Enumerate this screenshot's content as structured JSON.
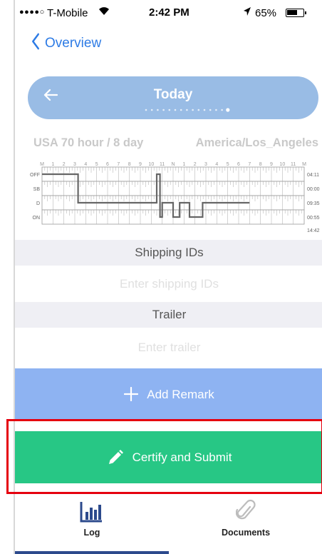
{
  "status_bar": {
    "signal": "●●●●○",
    "carrier": "T-Mobile",
    "time": "2:42 PM",
    "battery": "65%",
    "battery_level": 0.65
  },
  "nav": {
    "back_label": "Overview"
  },
  "day_selector": {
    "title": "Today",
    "page_count": 15,
    "active_page": 14
  },
  "log_info": {
    "ruleset": "USA 70 hour / 8 day",
    "timezone": "America/Los_Angeles"
  },
  "graph": {
    "hour_labels": [
      "M",
      "1",
      "2",
      "3",
      "4",
      "5",
      "6",
      "7",
      "8",
      "9",
      "10",
      "11",
      "N",
      "1",
      "2",
      "3",
      "4",
      "5",
      "6",
      "7",
      "8",
      "9",
      "10",
      "11",
      "M"
    ],
    "status_rows": [
      "OFF",
      "SB",
      "D",
      "ON"
    ],
    "totals": [
      "04:11",
      "00:00",
      "09:35",
      "00:55"
    ],
    "grand_total": "14:42",
    "line_color": "#666666"
  },
  "sections": {
    "shipping_header": "Shipping IDs",
    "shipping_placeholder": "Enter shipping IDs",
    "trailer_header": "Trailer",
    "trailer_placeholder": "Enter trailer"
  },
  "actions": {
    "add_remark": "Add Remark",
    "certify": "Certify and Submit"
  },
  "tabs": [
    {
      "label": "Log",
      "active": true
    },
    {
      "label": "Documents",
      "active": false
    }
  ],
  "colors": {
    "accent_blue": "#2d7be5",
    "pill_blue": "#99bce5",
    "remark_blue": "#8eb3f2",
    "certify_green": "#27c785",
    "highlight_red": "#e5000f",
    "tab_indicator": "#2c4a8c"
  }
}
